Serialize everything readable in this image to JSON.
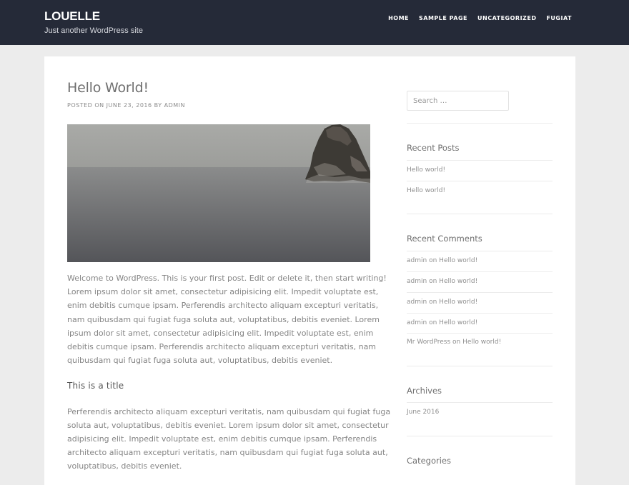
{
  "header": {
    "site_title": "LOUELLE",
    "tagline": "Just another WordPress site",
    "nav": [
      "HOME",
      "SAMPLE PAGE",
      "UNCATEGORIZED",
      "FUGIAT"
    ]
  },
  "post": {
    "title": "Hello World!",
    "meta_prefix": "POSTED ON",
    "date": "JUNE 23, 2016",
    "meta_by": "BY",
    "author": "ADMIN",
    "paragraph1": "Welcome to WordPress. This is your first post. Edit or delete it, then start writing! Lorem ipsum dolor sit amet, consectetur adipisicing elit. Impedit voluptate est, enim debitis cumque ipsam. Perferendis architecto aliquam excepturi veritatis, nam quibusdam qui fugiat fuga soluta aut, voluptatibus, debitis eveniet. Lorem ipsum dolor sit amet, consectetur adipisicing elit. Impedit voluptate est, enim debitis cumque ipsam. Perferendis architecto aliquam excepturi veritatis, nam quibusdam qui fugiat fuga soluta aut, voluptatibus, debitis eveniet.",
    "subheading": "This is a title",
    "paragraph2": "Perferendis architecto aliquam excepturi veritatis, nam quibusdam qui fugiat fuga soluta aut, voluptatibus, debitis eveniet. Lorem ipsum dolor sit amet, consectetur adipisicing elit. Impedit voluptate est, enim debitis cumque ipsam. Perferendis architecto aliquam excepturi veritatis, nam quibusdam qui fugiat fuga soluta aut, voluptatibus, debitis eveniet."
  },
  "sidebar": {
    "search_placeholder": "Search …",
    "recent_posts_title": "Recent Posts",
    "recent_posts": [
      "Hello world!",
      "Hello world!"
    ],
    "recent_comments_title": "Recent Comments",
    "recent_comments": [
      {
        "author": "admin",
        "on": "on",
        "post": "Hello world!"
      },
      {
        "author": "admin",
        "on": "on",
        "post": "Hello world!"
      },
      {
        "author": "admin",
        "on": "on",
        "post": "Hello world!"
      },
      {
        "author": "admin",
        "on": "on",
        "post": "Hello world!"
      },
      {
        "author": "Mr WordPress",
        "on": "on",
        "post": "Hello world!"
      }
    ],
    "archives_title": "Archives",
    "archives": [
      "June 2016"
    ],
    "categories_title": "Categories"
  }
}
